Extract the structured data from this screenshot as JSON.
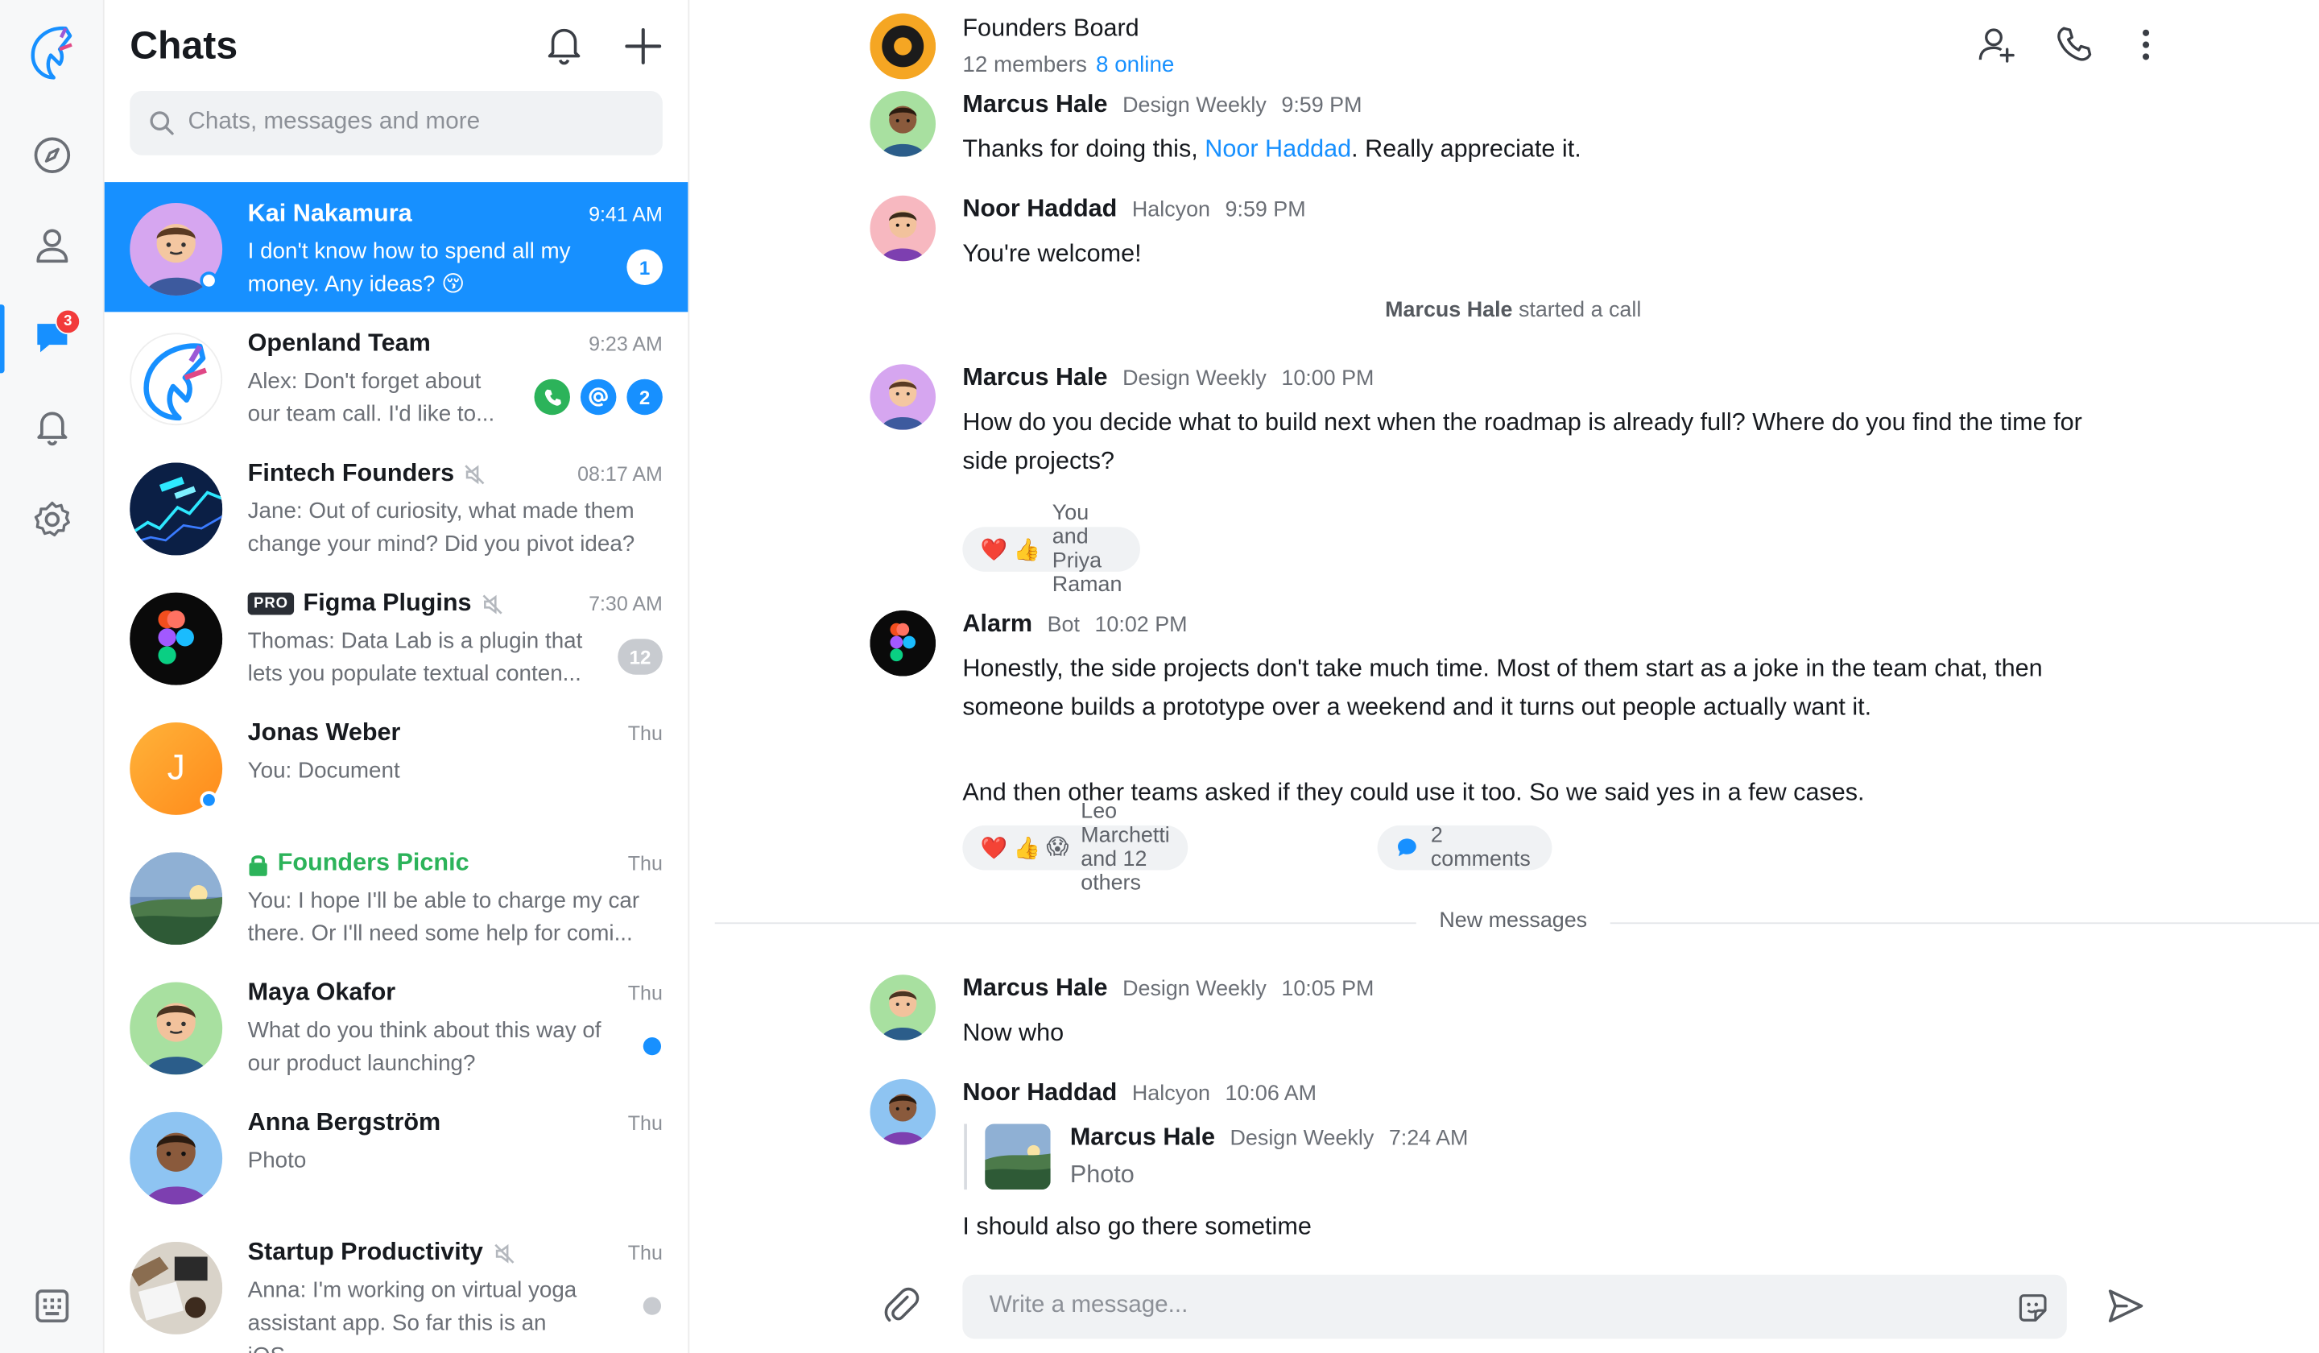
{
  "sidebar": {
    "notifications_badge": "3",
    "items": [
      "compass-icon",
      "person-icon",
      "chats-icon",
      "bell-icon",
      "settings-icon"
    ]
  },
  "chat_list": {
    "title": "Chats",
    "search_placeholder": "Chats, messages and more",
    "chats": [
      {
        "name": "Kai Nakamura",
        "time": "9:41 AM",
        "preview": "I don't know how to spend all my money. Any ideas? 😚",
        "badge": "1"
      },
      {
        "name": "Openland Team",
        "time": "9:23 AM",
        "preview": "Alex: Don't forget about our team call. I'd like to...",
        "badge": "2"
      },
      {
        "name": "Fintech Founders",
        "time": "08:17 AM",
        "preview": "Jane: Out of curiosity, what made them change your mind? Did you pivot idea?"
      },
      {
        "name": "Figma Plugins",
        "tag": "PRO",
        "time": "7:30 AM",
        "preview": "Thomas: Data Lab is a plugin that lets you populate textual conten...",
        "badge": "12"
      },
      {
        "name": "Jonas Weber",
        "time": "Thu",
        "preview": "You: Document",
        "initial": "J"
      },
      {
        "name": "Founders Picnic",
        "time": "Thu",
        "preview": "You: I hope I'll be able to charge my car there. Or I'll need some help for comi..."
      },
      {
        "name": "Maya Okafor",
        "time": "Thu",
        "preview": "What do you think about this way of our product launching?"
      },
      {
        "name": "Anna Bergström",
        "time": "Thu",
        "preview": "Photo"
      },
      {
        "name": "Startup Productivity",
        "time": "Thu",
        "preview": "Anna: I'm working on virtual yoga assistant app. So far this is an iOS..."
      }
    ]
  },
  "header": {
    "title": "Founders Board",
    "members": "12 members",
    "online": "8 online"
  },
  "messages": [
    {
      "name": "Marcus Hale",
      "org": "Design Weekly",
      "time": "9:59 PM",
      "text_before": "Thanks for doing this, ",
      "mention": "Noor Haddad",
      "text_after": ". Really appreciate it."
    },
    {
      "name": "Noor Haddad",
      "org": "Halcyon",
      "time": "9:59 PM",
      "text": "You're welcome!"
    },
    {
      "name": "Marcus Hale",
      "org": "Design Weekly",
      "time": "10:00 PM",
      "text": "How do you decide what to build next when the roadmap is already full? Where do you find the time for side projects?",
      "reactions": "You and Priya Raman"
    },
    {
      "name": "Alarm",
      "org": "Bot",
      "time": "10:02 PM",
      "text": "Honestly, the side projects don't take much time. Most of them start as a joke in the team chat, then someone builds a prototype over a weekend and it turns out people actually want it.",
      "text2": "And then other teams asked if they could use it too. So we said yes in a few cases.",
      "reactions": "Leo Marchetti and 12 others",
      "comments": "2 comments"
    },
    {
      "name": "Marcus Hale",
      "org": "Design Weekly",
      "time": "10:05 PM",
      "text": "Now who"
    },
    {
      "name": "Noor Haddad",
      "org": "Halcyon",
      "time": "10:06 AM",
      "text": "I should also go there sometime",
      "reply": {
        "name": "Marcus Hale",
        "org": "Design Weekly",
        "time": "7:24 AM",
        "text": "Photo"
      }
    }
  ],
  "system": {
    "actor": "Marcus Hale",
    "action": " started a call"
  },
  "divider": "New messages",
  "composer": {
    "placeholder": "Write a message..."
  },
  "colors": {
    "accent": "#1790ff",
    "green": "#2cb35a",
    "badge_red": "#f23b3b"
  }
}
